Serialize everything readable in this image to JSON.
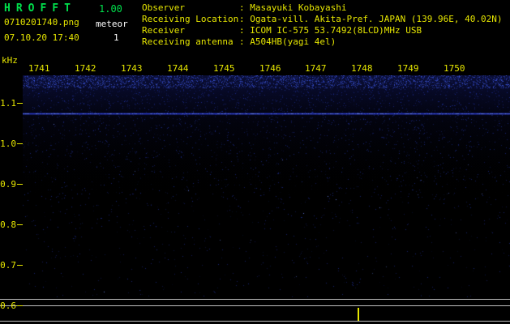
{
  "header": {
    "app_title": "HROFFT",
    "version": "1.00",
    "filename": "0710201740.png",
    "mode": "meteor",
    "timestamp": "07.10.20 17:40",
    "count": "1",
    "info_rows": [
      {
        "label": "Observer",
        "value": ": Masayuki Kobayashi"
      },
      {
        "label": "Receiving Location",
        "value": ": Ogata-vill. Akita-Pref. JAPAN (139.96E, 40.02N)"
      },
      {
        "label": "Receiver",
        "value": ": ICOM IC-575 53.7492(8LCD)MHz USB"
      },
      {
        "label": "Receiving antenna",
        "value": ": A504HB(yagi 4el)"
      }
    ]
  },
  "plot": {
    "freq_unit": "kHz",
    "time_labels": [
      "1741",
      "1742",
      "1743",
      "1744",
      "1745",
      "1746",
      "1747",
      "1748",
      "1749",
      "1750"
    ],
    "freq_ticks": [
      "1.1",
      "1.0",
      "0.9",
      "0.8",
      "0.7",
      "0.6"
    ],
    "carrier_khz": 1.075
  },
  "colors": {
    "background": "#000000",
    "title_green": "#00e04c",
    "label_yellow": "#e6e600",
    "value_white": "#ffffff",
    "noise_blue": "#2d46e6",
    "carrier_blue": "#5a78ff",
    "strip_line_gray": "#c0c0c0"
  },
  "chart_data": {
    "type": "heatmap",
    "title": "",
    "xlabel": "",
    "ylabel": "kHz",
    "x_tick_labels": [
      "1741",
      "1742",
      "1743",
      "1744",
      "1745",
      "1746",
      "1747",
      "1748",
      "1749",
      "1750"
    ],
    "y_tick_labels": [
      1.1,
      1.0,
      0.9,
      0.8,
      0.7,
      0.6
    ],
    "ylim": [
      0.62,
      1.17
    ],
    "grid": false,
    "legend": false,
    "series": [
      {
        "name": "carrier-line",
        "type": "horizontal-line",
        "y_khz": 1.075,
        "extent_x": "full-width"
      },
      {
        "name": "background-noise",
        "type": "speckle",
        "description": "blue noise speckle, densest near top of band, fading toward lower frequencies"
      }
    ],
    "bottom_strip": {
      "description": "signal-level strip chart with flat baseline",
      "marker_time": "between 1747 and 1748",
      "marker_color": "#e6e600"
    }
  }
}
